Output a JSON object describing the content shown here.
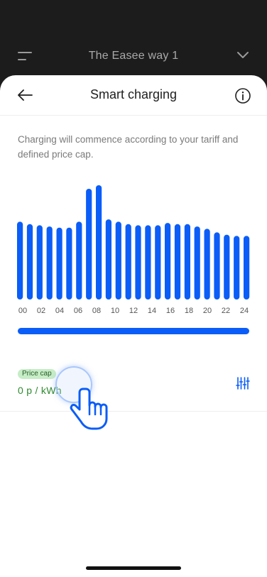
{
  "top_bar": {
    "title": "The Easee way 1"
  },
  "header": {
    "title": "Smart charging"
  },
  "description": "Charging will commence according to your tariff and defined price cap.",
  "price_cap": {
    "badge": "Price cap",
    "value": "0 p / kWh"
  },
  "icons": {
    "menu": "hamburger-menu-icon",
    "chevron": "chevron-down-icon",
    "back": "back-arrow-icon",
    "info": "info-icon",
    "settings": "sliders-settings-icon",
    "hand": "tap-hand-icon"
  },
  "colors": {
    "accent": "#0b5df7",
    "price_text": "#2f8a2f",
    "badge_bg": "#c6edc6"
  },
  "chart_data": {
    "type": "bar",
    "x_ticks": [
      "00",
      "02",
      "04",
      "06",
      "08",
      "10",
      "12",
      "14",
      "16",
      "18",
      "20",
      "22",
      "24"
    ],
    "values": [
      0.66,
      0.64,
      0.63,
      0.62,
      0.61,
      0.61,
      0.66,
      0.94,
      0.97,
      0.68,
      0.66,
      0.64,
      0.63,
      0.63,
      0.63,
      0.65,
      0.64,
      0.64,
      0.62,
      0.6,
      0.57,
      0.55,
      0.54,
      0.54
    ],
    "ylim": [
      0,
      1
    ],
    "color": "#0b5df7"
  }
}
